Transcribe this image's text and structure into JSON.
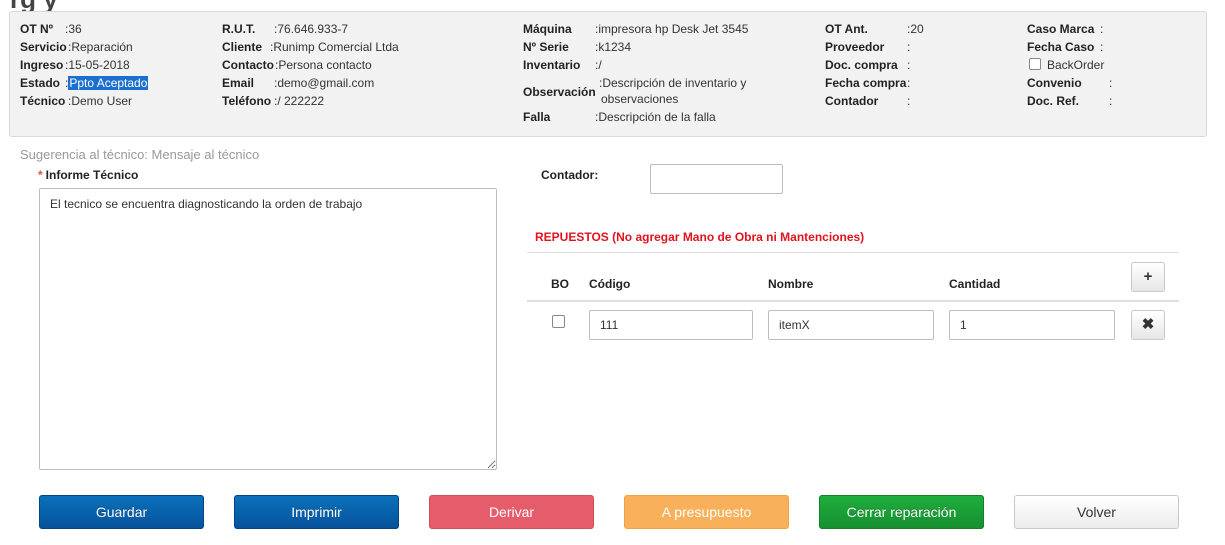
{
  "page": {
    "title_fragment": "rg y"
  },
  "info": {
    "col1": [
      {
        "label": "OT Nº",
        "value": ":36"
      },
      {
        "label": "Servicio",
        "value": ":Reparación"
      },
      {
        "label": "Ingreso",
        "value": ":15-05-2018"
      },
      {
        "label": "Estado",
        "value": ":",
        "highlight": "Ppto Aceptado"
      },
      {
        "label": "Técnico",
        "value": ":Demo User"
      }
    ],
    "col2": [
      {
        "label": "R.U.T.",
        "value": ":76.646.933-7"
      },
      {
        "label": "Cliente",
        "value": ":Runimp Comercial Ltda"
      },
      {
        "label": "Contacto",
        "value": ":Persona contacto"
      },
      {
        "label": "Email",
        "value": ":demo@gmail.com"
      },
      {
        "label": "Teléfono",
        "value": ":/ 222222"
      }
    ],
    "col3": [
      {
        "label": "Máquina",
        "value": ":impresora hp Desk Jet 3545"
      },
      {
        "label": "Nº Serie",
        "value": ":k1234"
      },
      {
        "label": "Inventario",
        "value": ":/"
      },
      {
        "label": "Observación",
        "value": ":Descripción de inventario y",
        "value2": "observaciones"
      },
      {
        "label": "Falla",
        "value": ":Descripción de la falla"
      }
    ],
    "col4": [
      {
        "label": "OT Ant.",
        "value": ":20"
      },
      {
        "label": "Proveedor",
        "value": ":"
      },
      {
        "label": "Doc. compra",
        "value": ":"
      },
      {
        "label": "Fecha compra",
        "value": ":"
      },
      {
        "label": "Contador",
        "value": ":"
      }
    ],
    "col5": [
      {
        "label": "Caso Marca",
        "value": ":"
      },
      {
        "label": "Fecha Caso",
        "value": ":"
      },
      {
        "label": "",
        "value": "BackOrder"
      },
      {
        "label": "Convenio",
        "value": ":"
      },
      {
        "label": "Doc. Ref.",
        "value": ":"
      }
    ]
  },
  "suggestion": "Sugerencia al técnico: Mensaje al técnico",
  "informe": {
    "required_mark": "*",
    "label": "Informe Técnico",
    "text": "El tecnico se encuentra diagnosticando la orden de trabajo"
  },
  "contador": {
    "label": "Contador:",
    "value": ""
  },
  "repuestos": {
    "title": "REPUESTOS (No agregar Mano de Obra ni Mantenciones)",
    "headers": {
      "bo": "BO",
      "codigo": "Código",
      "nombre": "Nombre",
      "cantidad": "Cantidad"
    },
    "add_icon": "plus-icon",
    "delete_icon": "times-icon",
    "rows": [
      {
        "codigo": "111",
        "nombre": "itemX",
        "cantidad": "1"
      }
    ]
  },
  "buttons": {
    "guardar": "Guardar",
    "imprimir": "Imprimir",
    "derivar": "Derivar",
    "presupuesto": "A presupuesto",
    "cerrar": "Cerrar reparación",
    "volver": "Volver"
  },
  "colors": {
    "primary": "#08529b",
    "danger": "#e55c6b",
    "warning": "#f8b15a",
    "success": "#16902f",
    "required": "#e0141e"
  }
}
